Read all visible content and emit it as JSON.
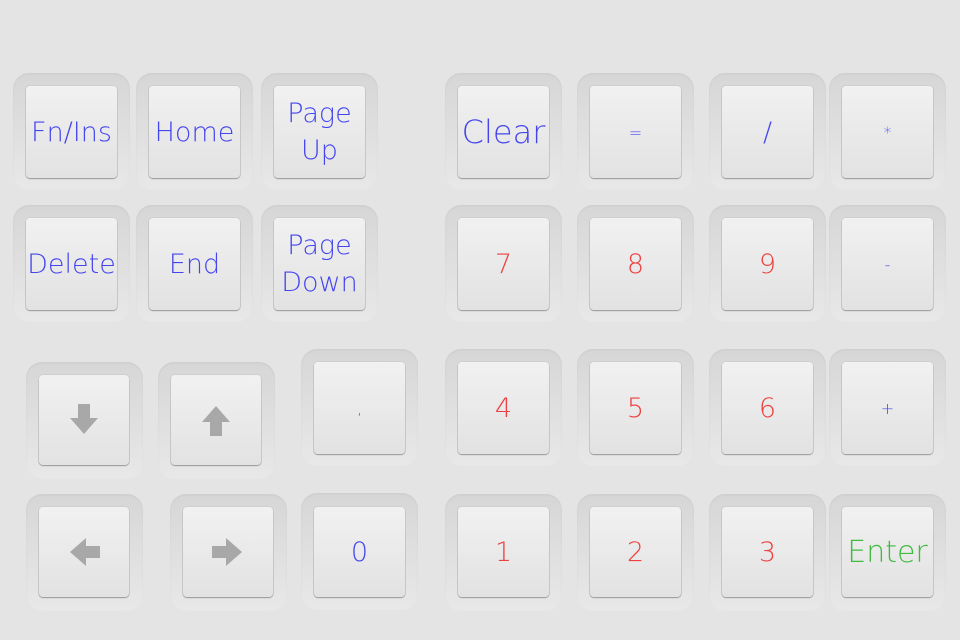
{
  "colors": {
    "nav": "#4545ee",
    "digit": "#ee4040",
    "enter": "#40bb40",
    "arrow": "#a8a8a8"
  },
  "nav_keys": {
    "fn_ins": "Fn/Ins",
    "home": "Home",
    "page_up_1": "Page",
    "page_up_2": "Up",
    "delete": "Delete",
    "end": "End",
    "page_down_1": "Page",
    "page_down_2": "Down"
  },
  "arrow_keys": {
    "down": "arrow-down-icon",
    "up": "arrow-up-icon",
    "left": "arrow-left-icon",
    "right": "arrow-right-icon"
  },
  "numpad": {
    "clear": "Clear",
    "equals": "=",
    "divide": "/",
    "multiply": "*",
    "minus": "-",
    "plus": "+",
    "enter": "Enter",
    "decimal": ",",
    "zero": "0",
    "d7": "7",
    "d8": "8",
    "d9": "9",
    "d4": "4",
    "d5": "5",
    "d6": "6",
    "d1": "1",
    "d2": "2",
    "d3": "3"
  }
}
